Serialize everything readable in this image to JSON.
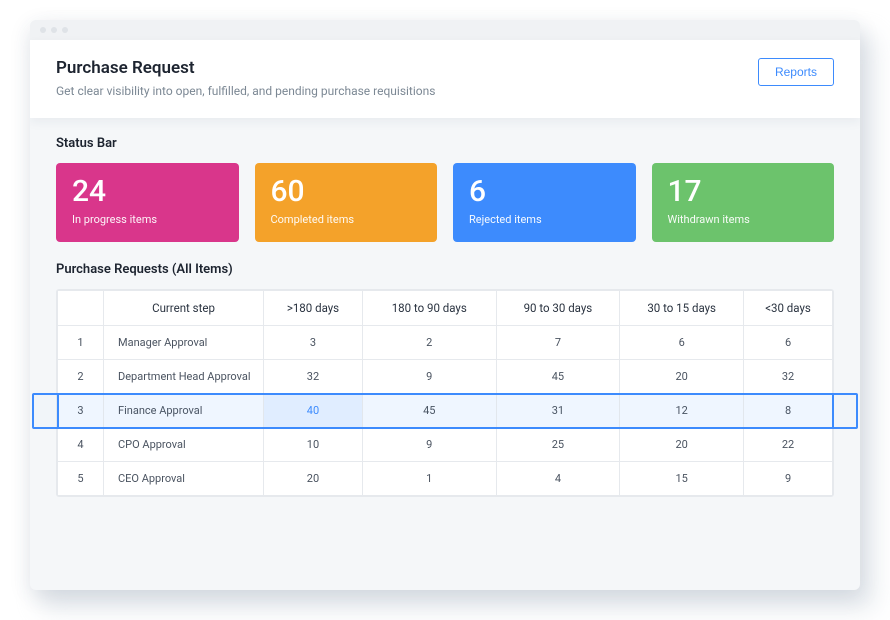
{
  "header": {
    "title": "Purchase Request",
    "subtitle": "Get clear visibility into open, fulfilled, and pending purchase requisitions",
    "reports_btn": "Reports"
  },
  "status": {
    "label": "Status Bar",
    "cards": [
      {
        "value": "24",
        "label": "In progress items",
        "color": "pink"
      },
      {
        "value": "60",
        "label": "Completed items",
        "color": "orange"
      },
      {
        "value": "6",
        "label": "Rejected items",
        "color": "blue"
      },
      {
        "value": "17",
        "label": "Withdrawn items",
        "color": "green"
      }
    ]
  },
  "table": {
    "title": "Purchase Requests (All Items)",
    "columns": [
      "",
      "Current step",
      ">180 days",
      "180 to 90 days",
      "90 to 30 days",
      "30 to 15 days",
      "<30 days"
    ],
    "rows": [
      {
        "idx": "1",
        "step": "Manager Approval",
        "cells": [
          "3",
          "2",
          "7",
          "6",
          "6"
        ],
        "highlight": false
      },
      {
        "idx": "2",
        "step": "Department Head Approval",
        "cells": [
          "32",
          "9",
          "45",
          "20",
          "32"
        ],
        "highlight": false
      },
      {
        "idx": "3",
        "step": "Finance Approval",
        "cells": [
          "40",
          "45",
          "31",
          "12",
          "8"
        ],
        "highlight": true,
        "highlight_col": 0
      },
      {
        "idx": "4",
        "step": "CPO Approval",
        "cells": [
          "10",
          "9",
          "25",
          "20",
          "22"
        ],
        "highlight": false
      },
      {
        "idx": "5",
        "step": "CEO Approval",
        "cells": [
          "20",
          "1",
          "4",
          "15",
          "9"
        ],
        "highlight": false
      }
    ]
  }
}
